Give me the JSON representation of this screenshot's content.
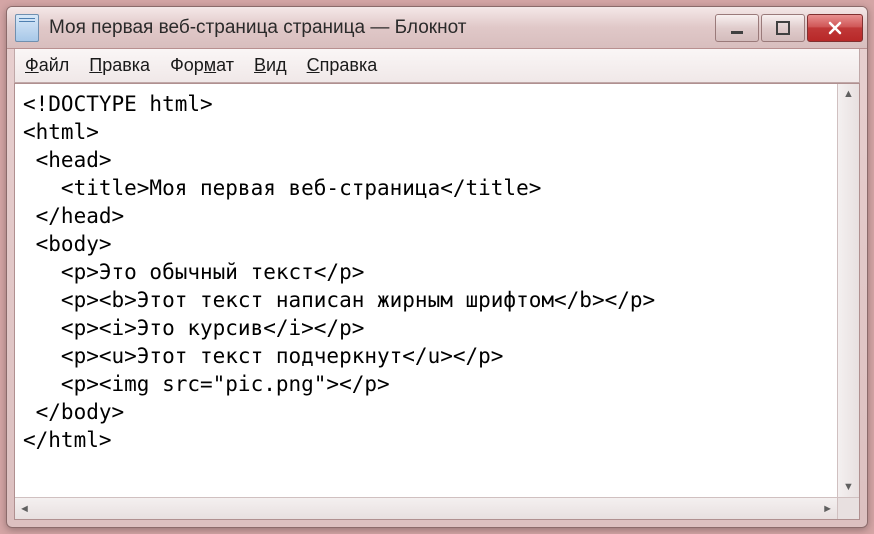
{
  "window": {
    "title": "Моя первая веб-страница страница — Блокнот"
  },
  "menu": {
    "file": "Файл",
    "edit": "Правка",
    "format": "Формат",
    "view": "Вид",
    "help": "Справка"
  },
  "editor": {
    "lines": [
      "<!DOCTYPE html>",
      "<html>",
      " <head>",
      "   <title>Моя первая веб-страница</title>",
      " </head>",
      " <body>",
      "   <p>Это обычный текст</p>",
      "   <p><b>Этот текст написан жирным шрифтом</b></p>",
      "   <p><i>Это курсив</i></p>",
      "   <p><u>Этот текст подчеркнут</u></p>",
      "   <p><img src=\"pic.png\"></p>",
      " </body>",
      "</html>"
    ]
  }
}
